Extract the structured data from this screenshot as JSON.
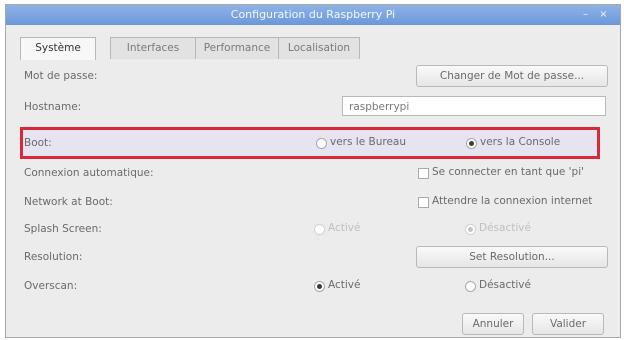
{
  "window": {
    "title": "Configuration du Raspberry Pi",
    "minimize_glyph": "–",
    "close_glyph": "×"
  },
  "tabs": [
    {
      "label": "Système"
    },
    {
      "label": "Interfaces"
    },
    {
      "label": "Performance"
    },
    {
      "label": "Localisation"
    }
  ],
  "rows": {
    "password": {
      "label": "Mot de passe:",
      "button": "Changer de Mot de passe..."
    },
    "hostname": {
      "label": "Hostname:",
      "value": "raspberrypi"
    },
    "boot": {
      "label": "Boot:",
      "opt1": "vers le Bureau",
      "opt2": "vers la Console",
      "selected": "opt2"
    },
    "autologin": {
      "label": "Connexion automatique:",
      "check_label": "Se connecter en tant que 'pi'"
    },
    "network_boot": {
      "label": "Network at Boot:",
      "check_label": "Attendre la connexion internet"
    },
    "splash": {
      "label": "Splash Screen:",
      "opt1": "Activé",
      "opt2": "Désactivé"
    },
    "resolution": {
      "label": "Resolution:",
      "button": "Set Resolution..."
    },
    "overscan": {
      "label": "Overscan:",
      "opt1": "Activé",
      "opt2": "Désactivé"
    }
  },
  "buttons": {
    "cancel": "Annuler",
    "ok": "Valider"
  },
  "colors": {
    "highlight_border": "#d82939",
    "titlebar": "#7aa3e0"
  }
}
